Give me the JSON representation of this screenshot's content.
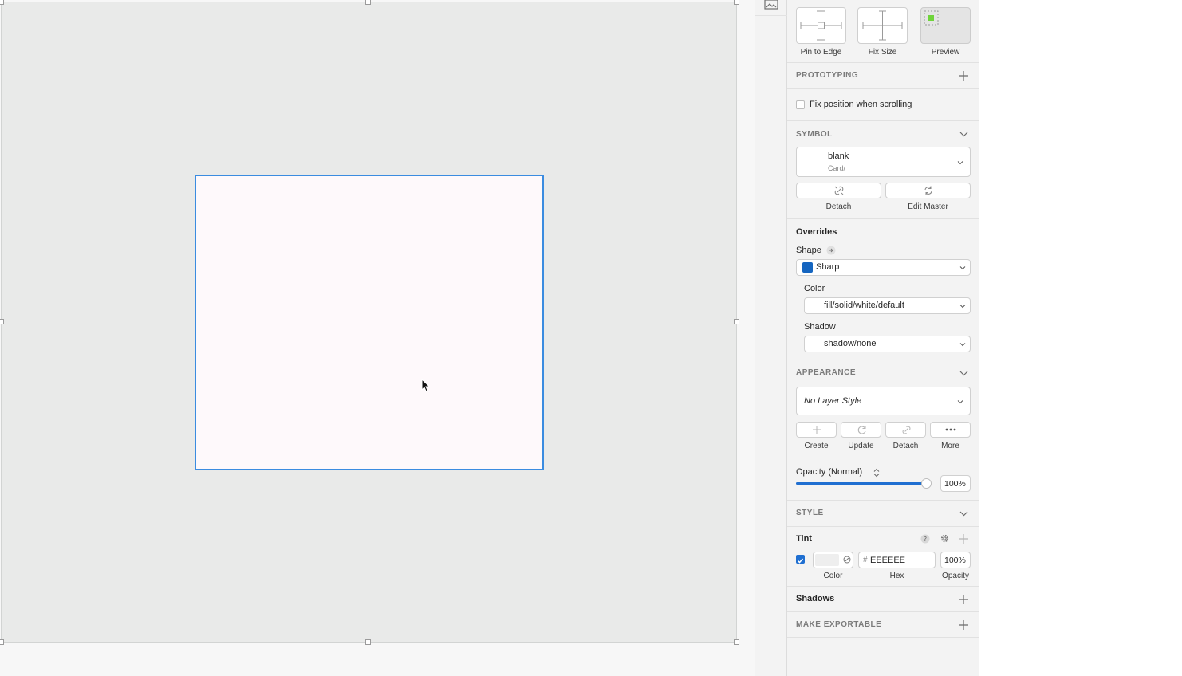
{
  "colors": {
    "accent": "#1f6fd1",
    "selection": "#3b8ce0",
    "shape_swatch": "#1565c0",
    "preview_green": "#6fd43b",
    "artboard": "#e9eae9"
  },
  "resizing": {
    "pin_label": "Pin to Edge",
    "fix_label": "Fix Size",
    "preview_label": "Preview"
  },
  "prototyping": {
    "title": "PROTOTYPING",
    "fix_position_label": "Fix position when scrolling",
    "fix_position_checked": false
  },
  "symbol": {
    "title": "SYMBOL",
    "name": "blank",
    "path": "Card/",
    "detach_label": "Detach",
    "edit_master_label": "Edit Master"
  },
  "overrides": {
    "title": "Overrides",
    "shape_label": "Shape",
    "shape_value": "Sharp",
    "color_label": "Color",
    "color_value": "fill/solid/white/default",
    "shadow_label": "Shadow",
    "shadow_value": "shadow/none"
  },
  "appearance": {
    "title": "APPEARANCE",
    "layer_style": "No Layer Style",
    "create_label": "Create",
    "update_label": "Update",
    "detach_label": "Detach",
    "more_label": "More",
    "opacity_label": "Opacity (Normal)",
    "opacity_value": "100%",
    "opacity_fraction": 1.0
  },
  "style": {
    "title": "STYLE",
    "tint_label": "Tint",
    "tint_checked": true,
    "hex_prefix": "#",
    "hex_value": "EEEEEE",
    "tint_opacity": "100%",
    "color_caption": "Color",
    "hex_caption": "Hex",
    "opacity_caption": "Opacity",
    "shadows_label": "Shadows"
  },
  "exportable": {
    "title": "MAKE EXPORTABLE"
  },
  "icons": [
    "image-icon",
    "plus-icon",
    "chevron-down-icon",
    "detach-link-icon",
    "sync-icon",
    "arrow-right-icon",
    "ellipsis-icon",
    "help-icon",
    "gear-icon",
    "cursor-icon"
  ]
}
